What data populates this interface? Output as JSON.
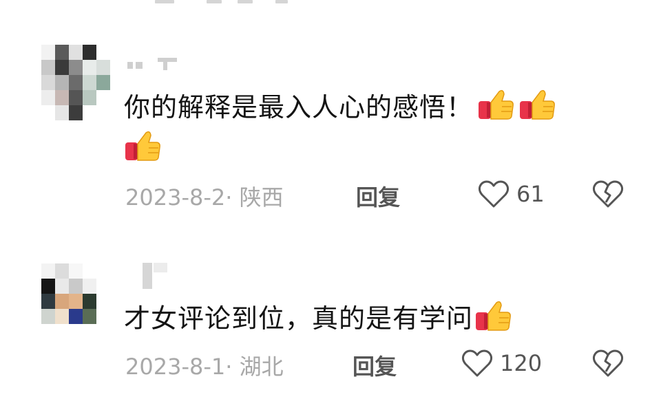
{
  "comments": [
    {
      "text": "你的解释是最入人心的感悟！",
      "emojis": [
        "thumbs-up",
        "thumbs-up",
        "thumbs-up"
      ],
      "date": "2023-8-2·",
      "location": "陕西",
      "reply_label": "回复",
      "likes": "61"
    },
    {
      "text": "才女评论到位，真的是有学问",
      "emojis": [
        "thumbs-up"
      ],
      "date": "2023-8-1·",
      "location": "湖北",
      "reply_label": "回复",
      "likes": "120"
    }
  ],
  "icons": {
    "like": "heart-outline-icon",
    "dislike": "broken-heart-icon",
    "emoji": "thumbs-up-emoji"
  },
  "colors": {
    "text": "#141414",
    "meta": "#a8a8a8",
    "action": "#555555"
  }
}
